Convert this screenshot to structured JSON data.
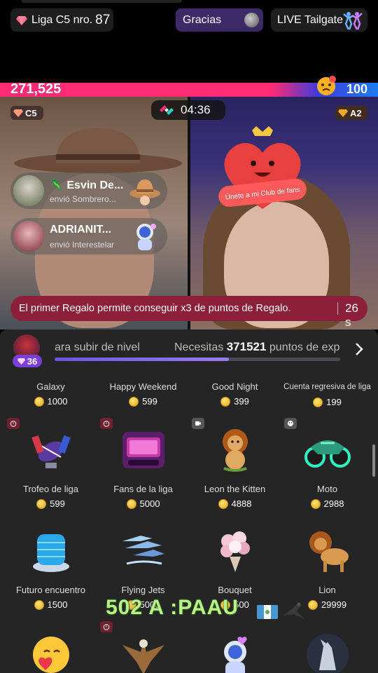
{
  "header": {
    "league_label": "Liga C5 nro.",
    "league_number": "87",
    "thanks_label": "Gracias",
    "live_label": "LIVE Tailgate"
  },
  "battle": {
    "score_left": "271,525",
    "score_right": "100",
    "timer": "04:36",
    "left_tier": "C5",
    "right_tier": "A2",
    "club_banner": "Únete a mi Club de fans",
    "colors": {
      "left": "#ff2a74",
      "right": "#1e7df0",
      "promo": "#8c1f3a"
    }
  },
  "notifications": [
    {
      "name": "🦎 Esvin De...",
      "action": "envió Sombrero...",
      "gift_icon": "cowboy-hat-icon"
    },
    {
      "name": "ADRIANIT...",
      "action": "envió Interestelar",
      "gift_icon": "astronaut-icon"
    }
  ],
  "promo": {
    "text": "El primer Regalo permite conseguir x3 de puntos de Regalo.",
    "seconds": "26 s"
  },
  "level": {
    "badge": "36",
    "left_text": "ara subir de nivel",
    "needs_label": "Necesitas",
    "points": "371521",
    "points_suffix": "puntos de exp",
    "progress": 0.61
  },
  "gifts": [
    {
      "name": "Galaxy",
      "price": "1000",
      "icon": "galaxy-icon"
    },
    {
      "name": "Happy Weekend",
      "price": "599",
      "icon": "happy-weekend-icon"
    },
    {
      "name": "Good Night",
      "price": "399",
      "icon": "good-night-icon"
    },
    {
      "name": "Cuenta regresiva de liga",
      "price": "199",
      "icon": "countdown-icon"
    },
    {
      "name": "Trofeo de liga",
      "price": "599",
      "icon": "football-trophy-icon",
      "tag": "timer"
    },
    {
      "name": "Fans de la liga",
      "price": "5000",
      "icon": "league-screen-icon",
      "tag": "timer"
    },
    {
      "name": "Leon the Kitten",
      "price": "4888",
      "icon": "lion-kitten-icon",
      "tag": "video"
    },
    {
      "name": "Moto",
      "price": "2988",
      "icon": "motorcycle-icon",
      "tag": "palette"
    },
    {
      "name": "Futuro encuentro",
      "price": "1500",
      "icon": "future-building-icon"
    },
    {
      "name": "Flying Jets",
      "price": "5000",
      "icon": "jets-icon"
    },
    {
      "name": "Bouquet",
      "price": "500",
      "icon": "bouquet-icon"
    },
    {
      "name": "Lion",
      "price": "29999",
      "icon": "lion-icon"
    }
  ],
  "bottom_row_icons": [
    "hug-emoji-icon",
    "eagle-icon",
    "astronaut-heart-icon",
    "wolf-icon"
  ],
  "overlay_text": "502 A :PAAU"
}
